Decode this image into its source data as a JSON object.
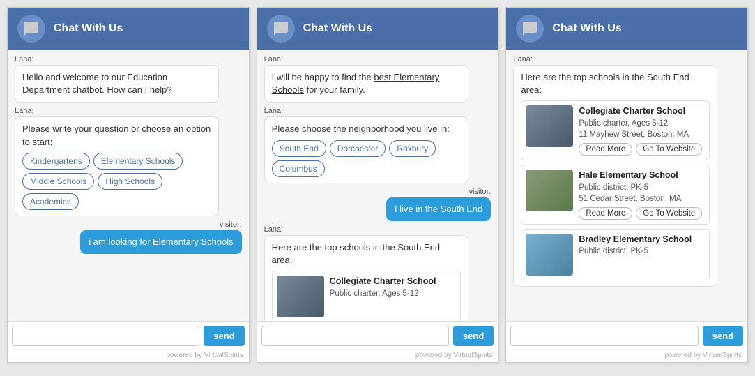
{
  "header": {
    "title": "Chat With Us"
  },
  "footer": {
    "text": "powered by VirtualSpirits"
  },
  "send": {
    "label": "send"
  },
  "widget1": {
    "header_title": "Chat With Us",
    "messages": [
      {
        "sender": "Lana",
        "text": "Hello and welcome to our Education Department chatbot. How can I help?"
      },
      {
        "sender": "Lana",
        "text": "Please write your question or choose an option to start:"
      }
    ],
    "options": [
      "Kindergartens",
      "Elementary Schools",
      "Middle Schools",
      "High Schools",
      "Academics"
    ],
    "visitor_label": "visitor:",
    "visitor_msg": "i am looking for Elementary Schools",
    "input_placeholder": "",
    "send_label": "send"
  },
  "widget2": {
    "header_title": "Chat With Us",
    "messages": [
      {
        "sender": "Lana",
        "text": "I will be happy to find the best Elementary Schools for your family."
      },
      {
        "sender": "Lana",
        "text": "Please choose the neighborhood you live in:"
      }
    ],
    "neighborhood_options": [
      "South End",
      "Dorchester",
      "Roxbury",
      "Columbus"
    ],
    "visitor_label": "visitor:",
    "visitor_msg": "I live in the South End",
    "lana_response": "Here are the top schools in the South End area:",
    "school_preview": {
      "name": "Collegiate Charter School",
      "type": "Public charter, Ages 5-12"
    },
    "input_placeholder": "",
    "send_label": "send"
  },
  "widget3": {
    "header_title": "Chat With Us",
    "lana_label": "Lana:",
    "lana_intro": "Here are the top schools in the South End area:",
    "schools": [
      {
        "name": "Collegiate Charter School",
        "type": "Public charter, Ages 5-12",
        "address": "11 Mayhew Street, Boston, MA",
        "img_class": "img-collegiate",
        "read_more": "Read More",
        "go_to_website": "Go To Website"
      },
      {
        "name": "Hale Elementary School",
        "type": "Public district, PK-5",
        "address": "51 Cedar Street, Boston, MA",
        "img_class": "img-hale",
        "read_more": "Read More",
        "go_to_website": "Go To Website"
      },
      {
        "name": "Bradley Elementary School",
        "type": "Public district, PK-5",
        "address": "",
        "img_class": "img-bradley",
        "read_more": "",
        "go_to_website": ""
      }
    ],
    "input_placeholder": "",
    "send_label": "send"
  }
}
